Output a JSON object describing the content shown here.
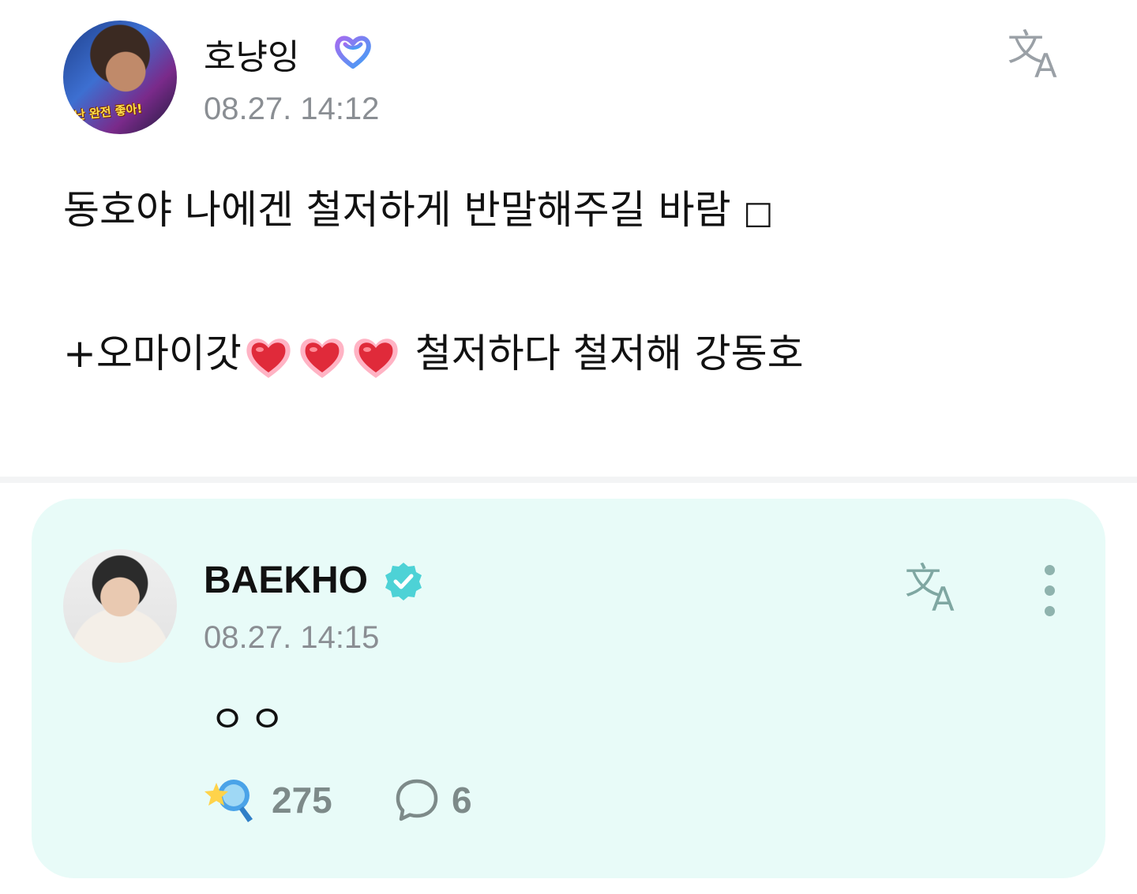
{
  "post": {
    "author": {
      "name": "호냥잉",
      "avatar_caption": "난 완전 좋아!",
      "badge_icon": "fan-heart-badge-icon"
    },
    "timestamp": "08.27. 14:12",
    "translate_icon_glyph": "文A",
    "body": {
      "line1": "동호야 나에겐 철저하게 반말해주길 바람 ",
      "line1_emoji_placeholder": "□",
      "line2_prefix": "+오마이갓",
      "line2_suffix": " 철저하다 철저해 강동호",
      "hearts_count": 3
    }
  },
  "reply": {
    "author": {
      "name": "BAEKHO",
      "badge_icon": "verified-badge-icon"
    },
    "timestamp": "08.27. 14:15",
    "translate_icon_glyph": "文A",
    "text": "ㅇㅇ",
    "likes": "275",
    "comments": "6"
  },
  "colors": {
    "reply_background": "#e8fbf8",
    "timestamp": "#8a8e93",
    "verified_badge": "#4dd2d6",
    "fan_badge": "#6f6cf2"
  }
}
